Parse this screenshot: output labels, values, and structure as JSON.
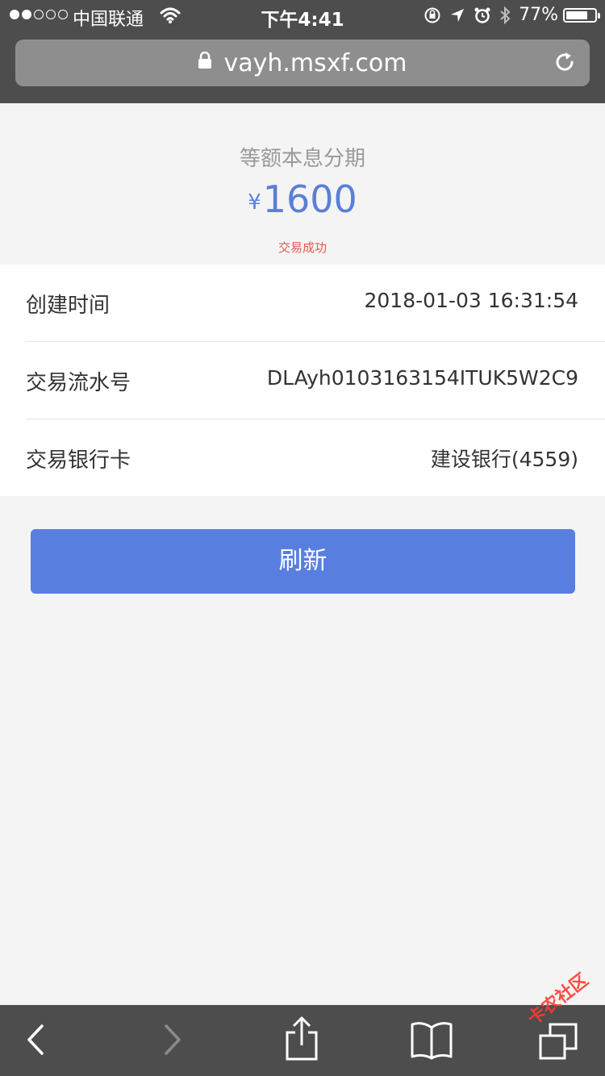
{
  "status_bar": {
    "carrier": "中国联通",
    "time": "下午4:41",
    "battery_pct": "77%",
    "battery_level": 0.77
  },
  "browser": {
    "url": "vayh.msxf.com"
  },
  "summary": {
    "product": "等额本息分期",
    "currency_symbol": "¥",
    "amount": "1600",
    "status": "交易成功"
  },
  "details": [
    {
      "label": "创建时间",
      "value": "2018-01-03 16:31:54"
    },
    {
      "label": "交易流水号",
      "value": "DLAyh0103163154ITUK5W2C9"
    },
    {
      "label": "交易银行卡",
      "value": "建设银行(4559)"
    }
  ],
  "actions": {
    "refresh_label": "刷新"
  },
  "watermark": {
    "text": "卡农社区"
  },
  "colors": {
    "accent": "#587fdf",
    "amount": "#5a7fd8",
    "success_text": "#e05a4f",
    "chrome": "#4d4d4d"
  }
}
